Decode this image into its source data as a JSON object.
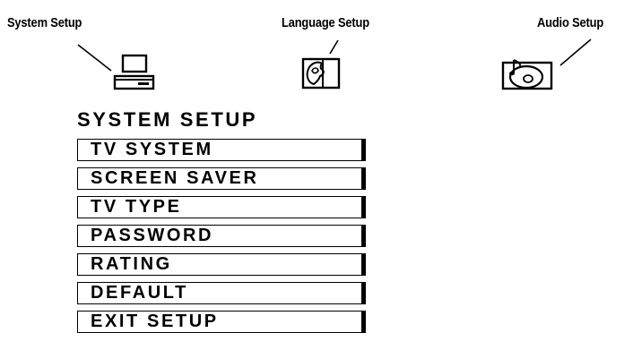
{
  "callouts": {
    "system_setup": "System Setup",
    "language_setup": "Language Setup",
    "audio_setup": "Audio Setup"
  },
  "icons": {
    "system": "computer-icon",
    "language": "language-icon",
    "audio": "audio-disc-icon"
  },
  "menu": {
    "title": "SYSTEM SETUP",
    "items": [
      "TV SYSTEM",
      "SCREEN SAVER",
      "TV TYPE",
      "PASSWORD",
      "RATING",
      "DEFAULT",
      "EXIT SETUP"
    ]
  }
}
